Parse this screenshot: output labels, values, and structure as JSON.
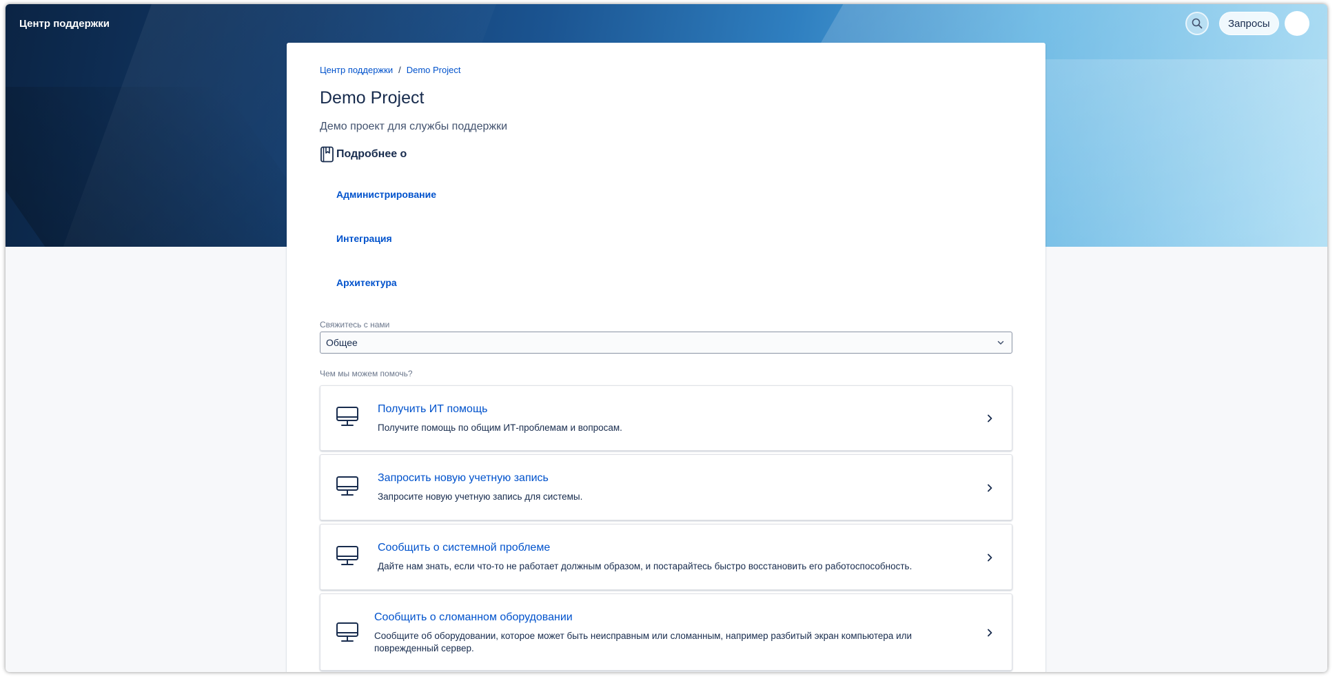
{
  "header": {
    "brand": "Центр поддержки",
    "requests_label": "Запросы",
    "search_icon": "search-icon"
  },
  "breadcrumb": {
    "root": "Центр поддержки",
    "separator": "/",
    "current": "Demo Project"
  },
  "project": {
    "title": "Demo Project",
    "description": "Демо проект для службы поддержки"
  },
  "knowledge_base": {
    "heading": "Подробнее о",
    "icon": "book-icon",
    "links": [
      {
        "label": "Администрирование"
      },
      {
        "label": "Интеграция"
      },
      {
        "label": "Архитектура"
      }
    ]
  },
  "contact": {
    "label": "Свяжитесь с нами",
    "selected": "Общее"
  },
  "help": {
    "label": "Чем мы можем помочь?",
    "items": [
      {
        "title": "Получить ИТ помощь",
        "description": "Получите помощь по общим ИТ-проблемам и вопросам.",
        "icon": "monitor-icon"
      },
      {
        "title": "Запросить новую учетную запись",
        "description": "Запросите новую учетную запись для системы.",
        "icon": "monitor-icon"
      },
      {
        "title": "Сообщить о системной проблеме",
        "description": "Дайте нам знать, если что-то не работает должным образом, и постарайтесь быстро восстановить его работоспособность.",
        "icon": "monitor-icon"
      },
      {
        "title": "Сообщить о сломанном оборудовании",
        "description": "Сообщите об оборудовании, которое может быть неисправным или сломанным, например разбитый экран компьютера или поврежденный сервер.",
        "icon": "monitor-icon"
      }
    ]
  },
  "colors": {
    "link": "#0052cc",
    "text": "#172b4d",
    "muted": "#6b778c",
    "page_bg": "#f7f8fa"
  }
}
